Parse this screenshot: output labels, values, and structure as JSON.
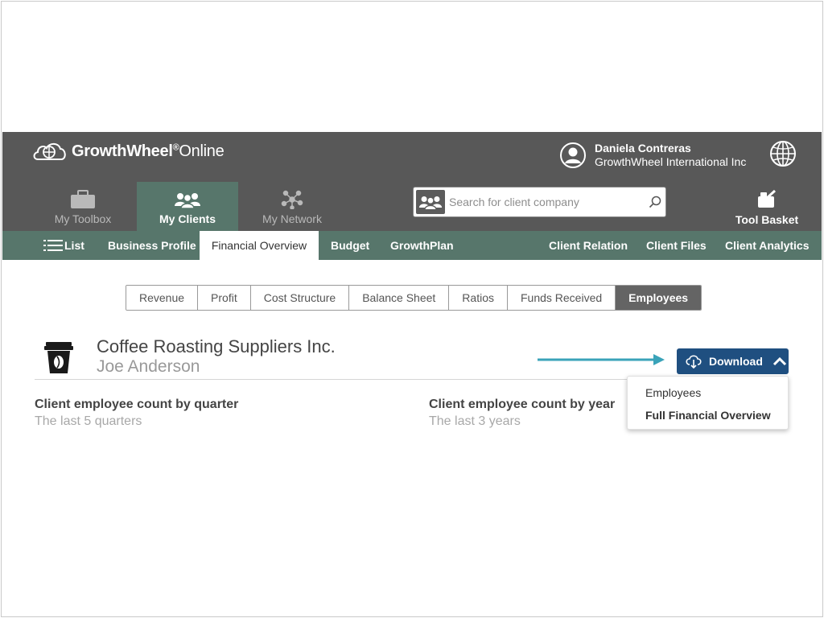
{
  "app": {
    "brand": "GrowthWheel",
    "brand_reg": "®",
    "brand_suffix": "Online"
  },
  "user": {
    "name": "Daniela Contreras",
    "company": "GrowthWheel International Inc"
  },
  "main_nav": {
    "tabs": [
      {
        "label": "My Toolbox",
        "icon": "toolbox-icon"
      },
      {
        "label": "My Clients",
        "icon": "clients-icon",
        "active": true
      },
      {
        "label": "My Network",
        "icon": "network-icon"
      }
    ],
    "search_placeholder": "Search for client company",
    "tool_basket": "Tool Basket"
  },
  "sub_nav": {
    "list": "List",
    "business_profile": "Business Profile",
    "financial_overview": "Financial Overview",
    "budget": "Budget",
    "growthplan": "GrowthPlan",
    "client_relation": "Client Relation",
    "client_files": "Client Files",
    "client_analytics": "Client Analytics"
  },
  "financial_tabs": [
    "Revenue",
    "Profit",
    "Cost Structure",
    "Balance Sheet",
    "Ratios",
    "Funds Received",
    "Employees"
  ],
  "financial_tabs_active": "Employees",
  "client": {
    "name": "Coffee Roasting Suppliers Inc.",
    "contact": "Joe Anderson"
  },
  "download": {
    "label": "Download",
    "menu": [
      "Employees",
      "Full Financial Overview"
    ]
  },
  "sections": {
    "quarter_title": "Client employee count by quarter",
    "quarter_sub": "The last 5 quarters",
    "year_title": "Client employee count by year",
    "year_sub": "The last 3 years"
  },
  "colors": {
    "header_bg": "#585858",
    "accent_green": "#57766b",
    "download_blue": "#1f4f80",
    "arrow_teal": "#3aa3b9"
  }
}
